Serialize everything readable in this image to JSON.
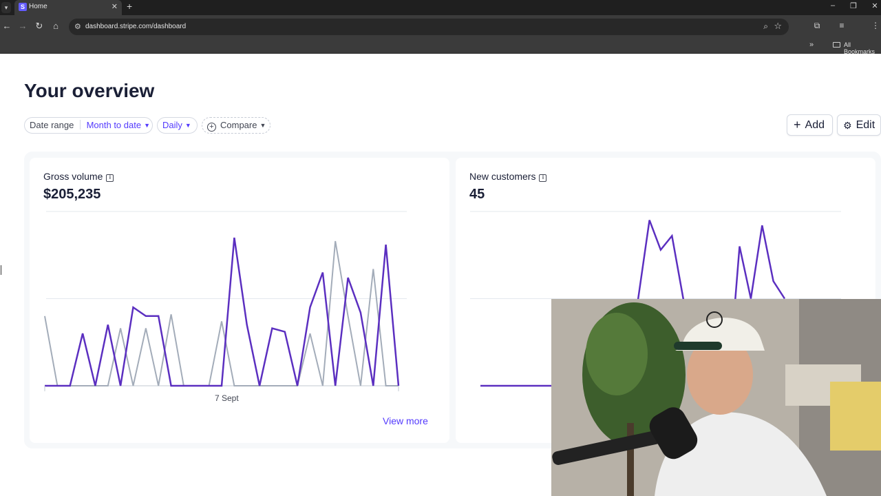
{
  "browser": {
    "tab_title": "Home",
    "favicon_letter": "S",
    "url": "dashboard.stripe.com/dashboard",
    "bookmarks_label": "All Bookmarks"
  },
  "page": {
    "title": "Your overview",
    "filters": {
      "date_range_label": "Date range",
      "date_range_value": "Month to date",
      "interval_value": "Daily",
      "compare_label": "Compare"
    },
    "actions": {
      "add_label": "Add",
      "edit_label": "Edit"
    }
  },
  "cards": {
    "gross_volume": {
      "title": "Gross volume",
      "value": "$205,235",
      "x_label": "7 Sept",
      "view_more": "View more"
    },
    "new_customers": {
      "title": "New customers",
      "value": "45"
    }
  },
  "colors": {
    "accent": "#533afd",
    "series_current": "#5b2fc0",
    "series_previous": "#a3acb9",
    "gridline": "#e3e8ee"
  },
  "chart_data": [
    {
      "type": "line",
      "title": "Gross volume",
      "x_tick_labels": [
        "7 Sept"
      ],
      "grid": true,
      "ylim": [
        0,
        1
      ],
      "series": [
        {
          "role": "current",
          "values": [
            0,
            0,
            0,
            0.3,
            0,
            0.35,
            0,
            0.45,
            0.4,
            0.4,
            0,
            0,
            0,
            0,
            0,
            0.85,
            0.35,
            0,
            0.33,
            0.31,
            0,
            0.45,
            0.65,
            0,
            0.62,
            0.42,
            0,
            0.81,
            0
          ]
        },
        {
          "role": "previous",
          "values": [
            0.4,
            0,
            0,
            0,
            0,
            0,
            0.33,
            0,
            0.33,
            0,
            0.41,
            0,
            0,
            0,
            0.37,
            0,
            0,
            0,
            0,
            0,
            0,
            0.3,
            0,
            0.83,
            0.4,
            0,
            0.67,
            0,
            0
          ]
        }
      ]
    },
    {
      "type": "line",
      "title": "New customers",
      "grid": true,
      "ylim": [
        0,
        1
      ],
      "series": [
        {
          "role": "current",
          "values": [
            0,
            0,
            0,
            0,
            0,
            0,
            0,
            0,
            0,
            0,
            0,
            0,
            0,
            0,
            0.5,
            0.95,
            0.78,
            0.86,
            0.5,
            0,
            0,
            0,
            0,
            0.8,
            0.5,
            0.92,
            0.6,
            0.5
          ]
        }
      ]
    }
  ]
}
